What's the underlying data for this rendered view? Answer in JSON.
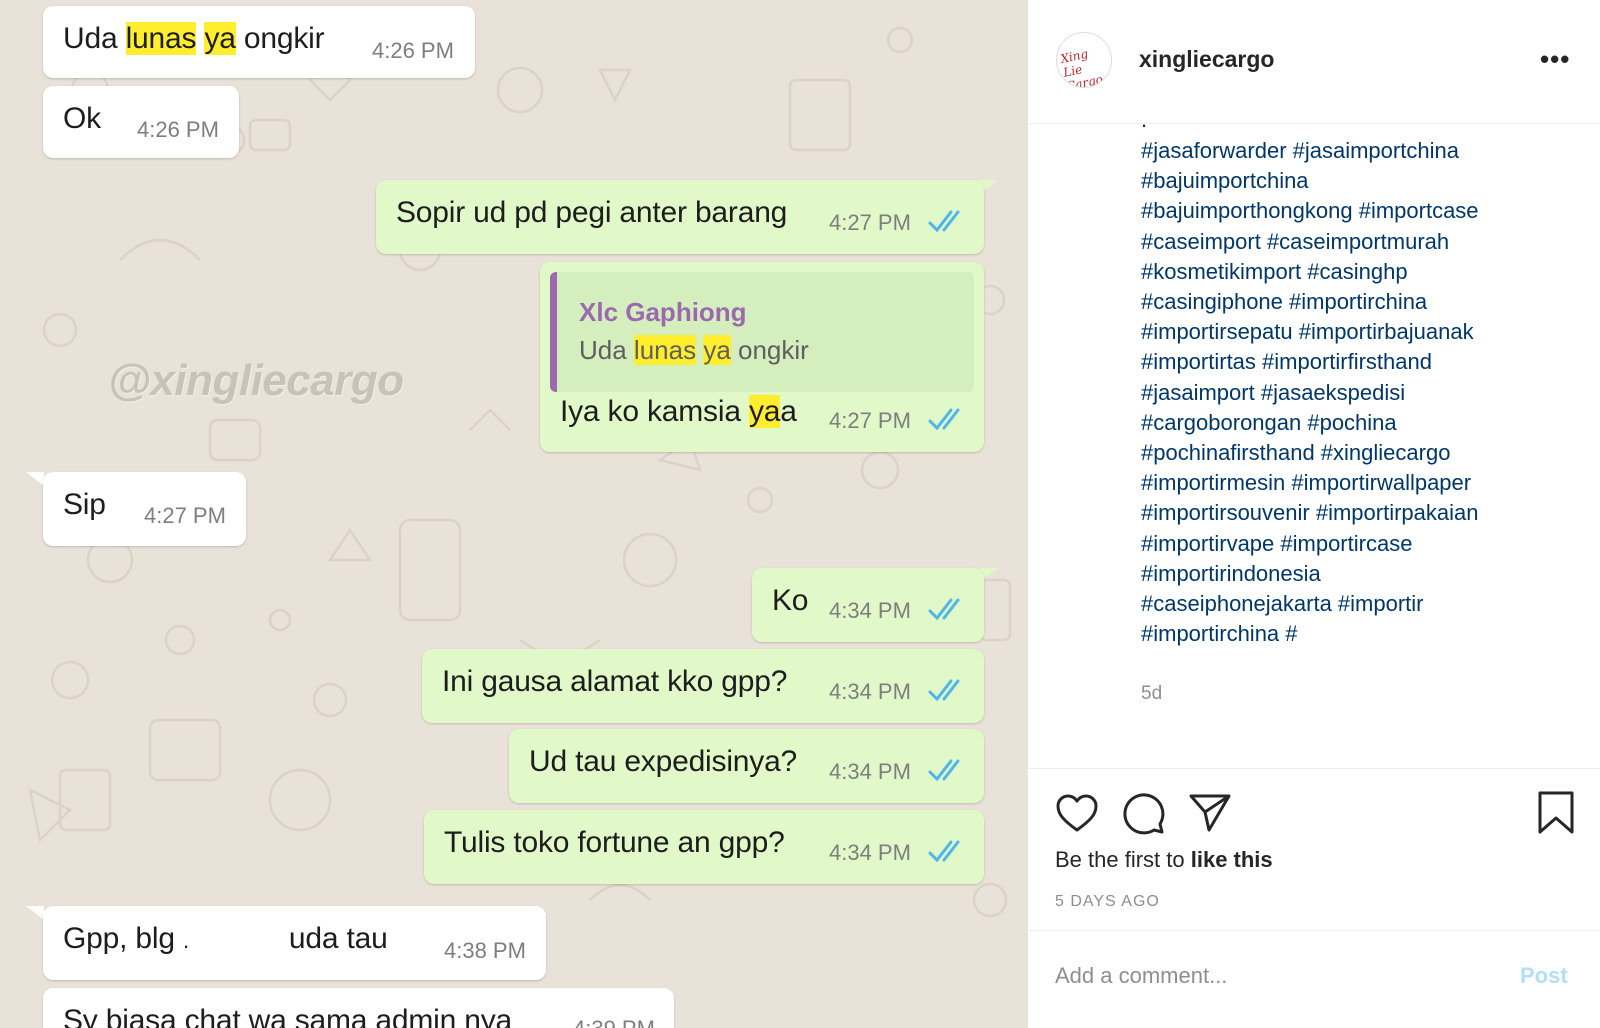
{
  "chat": {
    "watermark": "@xingliecargo",
    "messages": [
      {
        "dir": "in",
        "parts": [
          "Uda ",
          "lunas",
          " ",
          "ya",
          " ongkir"
        ],
        "time": "4:26 PM"
      },
      {
        "dir": "in",
        "text": "Ok",
        "time": "4:26 PM"
      },
      {
        "dir": "out",
        "text": "Sopir ud pd pegi anter barang",
        "time": "4:27 PM"
      },
      {
        "dir": "out",
        "quote": {
          "author": "Xlc Gaphiong",
          "parts": [
            "Uda ",
            "lunas",
            " ",
            "ya",
            " ongkir"
          ]
        },
        "parts": [
          "Iya ko kamsia ",
          "ya",
          "a"
        ],
        "time": "4:27 PM"
      },
      {
        "dir": "in",
        "text": "Sip",
        "time": "4:27 PM"
      },
      {
        "dir": "out",
        "text": "Ko",
        "time": "4:34 PM"
      },
      {
        "dir": "out",
        "text": "Ini gausa alamat kko gpp?",
        "time": "4:34 PM"
      },
      {
        "dir": "out",
        "text": "Ud tau expedisinya?",
        "time": "4:34 PM"
      },
      {
        "dir": "out",
        "text": "Tulis toko fortune an gpp?",
        "time": "4:34 PM"
      },
      {
        "dir": "in",
        "parts": [
          "Gpp,  blg ",
          ".",
          "uda tau"
        ],
        "time": "4:38 PM"
      },
      {
        "dir": "in",
        "text": "Sy biasa chat wa sama admin nya",
        "time": "4:39 PM"
      }
    ]
  },
  "ig": {
    "username": "xingliecargo",
    "avatar_text": "Xing Lie Cargo",
    "more_label": "•••",
    "caption_dot": ".",
    "caption_lines": [
      "#jasaforwarder #jasaimportchina",
      "#bajuimportchina",
      "#bajuimporthongkong #importcase",
      "#caseimport #caseimportmurah",
      "#kosmetikimport #casinghp",
      "#casingiphone #importirchina",
      "#importirsepatu #importirbajuanak",
      "#importirtas #importirfirsthand",
      "#jasaimport #jasaekspedisi",
      "#cargoborongan #pochina",
      "#pochinafirsthand #xingliecargo",
      "#importirmesin #importirwallpaper",
      "#importirsouvenir #importirpakaian",
      "#importirvape #importircase",
      "#importirindonesia",
      "#caseiphonejakarta #importir",
      "#importirchina #"
    ],
    "ago": "5d",
    "likes_prefix": "Be the first to ",
    "likes_bold": "like this",
    "date": "5 DAYS AGO",
    "comment_placeholder": "Add a comment...",
    "post_label": "Post",
    "icons": [
      "heart-icon",
      "comment-icon",
      "share-icon",
      "bookmark-icon"
    ],
    "colors": {
      "hashtag": "#00376b",
      "post_disabled": "#b2dffc",
      "chat_out": "#e1f8c8",
      "chat_in": "#ffffff",
      "highlight": "#ffee2e",
      "quote_author": "#9b6aae",
      "tick": "#4fb6ec"
    }
  }
}
